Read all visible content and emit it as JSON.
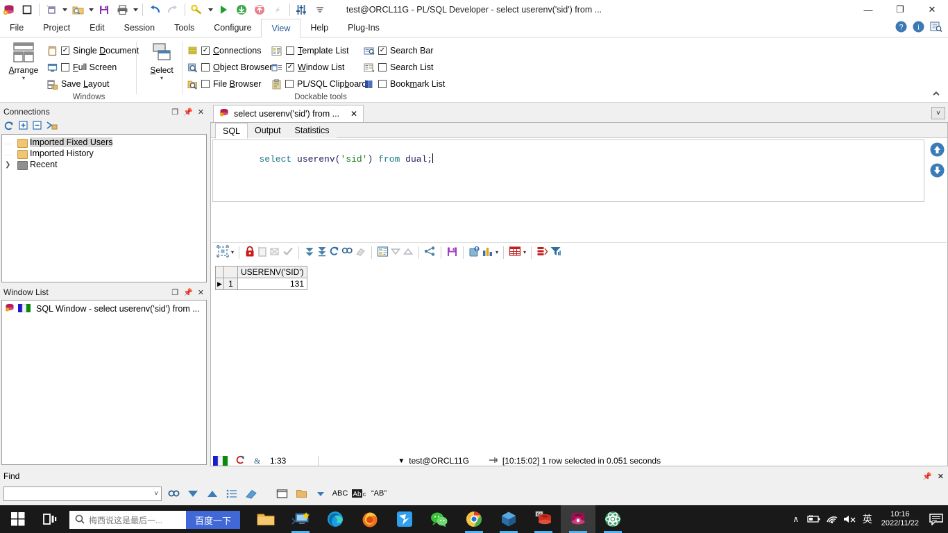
{
  "window": {
    "title": "test@ORCL11G - PL/SQL Developer - select userenv('sid') from ...",
    "minimize": "—",
    "maximize": "❐",
    "close": "✕"
  },
  "quick_access": {
    "new_label": "new-document",
    "open_label": "open",
    "save_label": "save",
    "print_label": "print",
    "undo_label": "undo",
    "redo_label": "redo",
    "find_label": "find",
    "execute_label": "execute",
    "import_label": "import",
    "export_label": "export",
    "break_label": "break",
    "settings_label": "settings",
    "more_label": "more"
  },
  "menu": {
    "items": [
      {
        "label": "File",
        "active": false
      },
      {
        "label": "Project",
        "active": false
      },
      {
        "label": "Edit",
        "active": false
      },
      {
        "label": "Session",
        "active": false
      },
      {
        "label": "Tools",
        "active": false
      },
      {
        "label": "Configure",
        "active": false
      },
      {
        "label": "View",
        "active": true
      },
      {
        "label": "Help",
        "active": false
      },
      {
        "label": "Plug-Ins",
        "active": false
      }
    ],
    "help_icon": "?",
    "info_icon": "i",
    "lookup_icon": "lookup"
  },
  "ribbon": {
    "groups": [
      {
        "name": "Windows",
        "label": "Windows"
      },
      {
        "name": "Dockable tools",
        "label": "Dockable tools"
      }
    ],
    "arrange_label": "Arrange",
    "select_label": "Select",
    "windows_checks": [
      {
        "label": "Single Document",
        "checked": true,
        "accel": "D"
      },
      {
        "label": "Full Screen",
        "checked": false,
        "accel": "F"
      },
      {
        "label": "Save Layout",
        "checked": null,
        "accel": "L"
      }
    ],
    "dock_col1": [
      {
        "label": "Connections",
        "checked": true
      },
      {
        "label": "Object Browser",
        "checked": false
      },
      {
        "label": "File Browser",
        "checked": false
      }
    ],
    "dock_col2": [
      {
        "label": "Template List",
        "checked": false
      },
      {
        "label": "Window List",
        "checked": true
      },
      {
        "label": "PL/SQL Clipboard",
        "checked": false
      }
    ],
    "dock_col3": [
      {
        "label": "Search Bar",
        "checked": true
      },
      {
        "label": "Search List",
        "checked": false
      },
      {
        "label": "Bookmark List",
        "checked": false
      }
    ],
    "collapse_icon": "▲"
  },
  "connections_panel": {
    "title": "Connections",
    "restore_icon": "❐",
    "pin_icon": "↯",
    "close_icon": "✕",
    "toolbar": [
      "refresh-icon",
      "expand-icon",
      "collapse-icon",
      "new-connection-icon"
    ],
    "tree": [
      {
        "label": "Imported Fixed Users",
        "color": "tan",
        "selected": true,
        "expandable": false
      },
      {
        "label": "Imported History",
        "color": "tan",
        "selected": false,
        "expandable": false
      },
      {
        "label": "Recent",
        "color": "gray",
        "selected": false,
        "expandable": true
      }
    ]
  },
  "window_list_panel": {
    "title": "Window List",
    "restore_icon": "❐",
    "pin_icon": "↯",
    "close_icon": "✕",
    "items": [
      {
        "label": "SQL Window - select userenv('sid') from ..."
      }
    ]
  },
  "document": {
    "tab_label": "select userenv('sid') from ...",
    "tab_close": "✕",
    "tabs_overflow": "˅",
    "subtabs": [
      {
        "label": "SQL",
        "active": true
      },
      {
        "label": "Output",
        "active": false
      },
      {
        "label": "Statistics",
        "active": false
      }
    ],
    "editor": {
      "tokens": [
        {
          "text": "select",
          "type": "kw"
        },
        {
          "text": " ",
          "type": "plain"
        },
        {
          "text": "userenv",
          "type": "id"
        },
        {
          "text": "(",
          "type": "punct"
        },
        {
          "text": "'sid'",
          "type": "str"
        },
        {
          "text": ")",
          "type": "punct"
        },
        {
          "text": " ",
          "type": "plain"
        },
        {
          "text": "from",
          "type": "kw"
        },
        {
          "text": " ",
          "type": "plain"
        },
        {
          "text": "dual",
          "type": "id"
        },
        {
          "text": ";",
          "type": "punct"
        }
      ],
      "full_text": "select userenv('sid') from dual;"
    },
    "nav_up_icon": "▲",
    "nav_down_icon": "▼"
  },
  "results_toolbar": {
    "buttons": [
      "grid-mode-icon",
      "grid-mode-dropdown",
      "lock-icon",
      "insert-row-icon",
      "delete-row-icon",
      "post-changes-icon",
      "next-page-icon",
      "last-page-icon",
      "refresh-icon",
      "find-icon",
      "clear-icon",
      "single-record-icon",
      "collapse-icon",
      "expand-icon",
      "link-icon",
      "save-icon",
      "export-icon",
      "chart-icon",
      "chart-dropdown",
      "grid-icon",
      "grid-dropdown",
      "copy-icon",
      "filter-icon"
    ]
  },
  "results_grid": {
    "columns": [
      "USERENV('SID')"
    ],
    "rows": [
      {
        "num": "1",
        "values": [
          "131"
        ],
        "current": true
      }
    ]
  },
  "status_bar": {
    "cursor_position": "1:33",
    "connection": "test@ORCL11G",
    "connection_dropdown": "▼",
    "message": "[10:15:02]  1 row selected in 0.051 seconds"
  },
  "find_panel": {
    "title": "Find",
    "pin_icon": "↯",
    "close_icon": "✕",
    "input_value": "",
    "input_placeholder": "",
    "dropdown_icon": "˅",
    "buttons": [
      "find-icon",
      "find-next-icon",
      "find-previous-icon",
      "find-list-icon",
      "clear-highlight-icon",
      "scope-window-icon",
      "scope-folder-icon",
      "scope-dropdown-icon",
      "case-sensitive-icon",
      "match-word-icon",
      "whole-word-icon"
    ],
    "abc_label": "ABC",
    "ab_case_label": "AB",
    "ab_quote_label": "\"AB\""
  },
  "taskbar": {
    "start_label": "start-button",
    "task_view_label": "task-view-button",
    "search_value": "梅西说这是最后一...",
    "search_button_label": "百度一下",
    "apps": [
      {
        "name": "file-explorer",
        "active": false,
        "running": false
      },
      {
        "name": "remote-desktop",
        "active": false,
        "running": true
      },
      {
        "name": "microsoft-edge",
        "active": false,
        "running": false
      },
      {
        "name": "firefox",
        "active": false,
        "running": false
      },
      {
        "name": "blue-bird-app",
        "active": false,
        "running": false
      },
      {
        "name": "wechat",
        "active": false,
        "running": false
      },
      {
        "name": "google-chrome",
        "active": false,
        "running": true
      },
      {
        "name": "virtualbox",
        "active": false,
        "running": true
      },
      {
        "name": "oracle-64",
        "active": false,
        "running": true
      },
      {
        "name": "plsql-developer",
        "active": true,
        "running": true
      },
      {
        "name": "atom-editor",
        "active": false,
        "running": true
      }
    ],
    "tray": {
      "chevron": "∧",
      "battery_icon": "battery",
      "wifi_icon": "wifi",
      "volume_icon": "volume-muted",
      "ime_label": "英",
      "time": "10:16",
      "date": "2022/11/22",
      "action_center_icon": "notifications"
    }
  }
}
